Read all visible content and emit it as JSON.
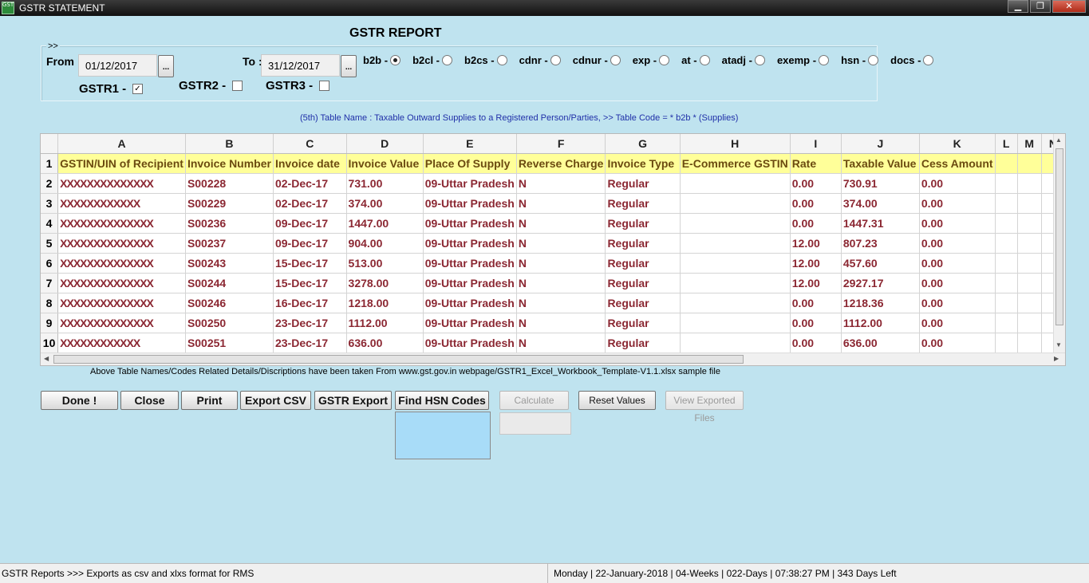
{
  "window": {
    "title": "GSTR STATEMENT",
    "app_icon_text": "GST",
    "controls": {
      "minimize": "▁",
      "maximize": "❐",
      "close": "✕"
    }
  },
  "heading": "GSTR REPORT",
  "filter": {
    "legend": ">>",
    "from_label": "From :",
    "from_value": "01/12/2017",
    "to_label": "To :",
    "to_value": "31/12/2017",
    "picker_label": "...",
    "gstr1_label": "GSTR1 -",
    "gstr1_checked": true,
    "gstr2_label": "GSTR2 -",
    "gstr2_checked": false,
    "gstr3_label": "GSTR3 -",
    "gstr3_checked": false,
    "table_codes": [
      {
        "label": "b2b -",
        "selected": true
      },
      {
        "label": "b2cl -",
        "selected": false
      },
      {
        "label": "b2cs -",
        "selected": false
      },
      {
        "label": "cdnr -",
        "selected": false
      },
      {
        "label": "cdnur -",
        "selected": false
      },
      {
        "label": "exp -",
        "selected": false
      },
      {
        "label": "at -",
        "selected": false
      },
      {
        "label": "atadj -",
        "selected": false
      },
      {
        "label": "exemp -",
        "selected": false
      },
      {
        "label": "hsn -",
        "selected": false
      },
      {
        "label": "docs -",
        "selected": false
      }
    ]
  },
  "table_note": "(5th) Table Name : Taxable Outward Supplies to a Registered Person/Parties, >> Table Code = * b2b * (Supplies)",
  "grid": {
    "columns": [
      "A",
      "B",
      "C",
      "D",
      "E",
      "F",
      "G",
      "H",
      "I",
      "J",
      "K",
      "L",
      "M",
      "N"
    ],
    "header_row": {
      "num": "1",
      "cells": [
        "GSTIN/UIN of Recipient",
        "Invoice Number",
        "Invoice date",
        "Invoice Value",
        "Place Of Supply",
        "Reverse Charge",
        "Invoice Type",
        "E-Commerce GSTIN",
        "Rate",
        "Taxable Value",
        "Cess Amount",
        "",
        "",
        ""
      ]
    },
    "rows": [
      {
        "num": "2",
        "cells": [
          "XXXXXXXXXXXXXX",
          "S00228",
          "02-Dec-17",
          "731.00",
          "09-Uttar Pradesh",
          "N",
          "Regular",
          "",
          "0.00",
          "730.91",
          "0.00",
          "",
          "",
          ""
        ]
      },
      {
        "num": "3",
        "cells": [
          "XXXXXXXXXXXX",
          "S00229",
          "02-Dec-17",
          "374.00",
          "09-Uttar Pradesh",
          "N",
          "Regular",
          "",
          "0.00",
          "374.00",
          "0.00",
          "",
          "",
          ""
        ]
      },
      {
        "num": "4",
        "cells": [
          "XXXXXXXXXXXXXX",
          "S00236",
          "09-Dec-17",
          "1447.00",
          "09-Uttar Pradesh",
          "N",
          "Regular",
          "",
          "0.00",
          "1447.31",
          "0.00",
          "",
          "",
          ""
        ]
      },
      {
        "num": "5",
        "cells": [
          "XXXXXXXXXXXXXX",
          "S00237",
          "09-Dec-17",
          "904.00",
          "09-Uttar Pradesh",
          "N",
          "Regular",
          "",
          "12.00",
          "807.23",
          "0.00",
          "",
          "",
          ""
        ]
      },
      {
        "num": "6",
        "cells": [
          "XXXXXXXXXXXXXX",
          "S00243",
          "15-Dec-17",
          "513.00",
          "09-Uttar Pradesh",
          "N",
          "Regular",
          "",
          "12.00",
          "457.60",
          "0.00",
          "",
          "",
          ""
        ]
      },
      {
        "num": "7",
        "cells": [
          "XXXXXXXXXXXXXX",
          "S00244",
          "15-Dec-17",
          "3278.00",
          "09-Uttar Pradesh",
          "N",
          "Regular",
          "",
          "12.00",
          "2927.17",
          "0.00",
          "",
          "",
          ""
        ]
      },
      {
        "num": "8",
        "cells": [
          "XXXXXXXXXXXXXX",
          "S00246",
          "16-Dec-17",
          "1218.00",
          "09-Uttar Pradesh",
          "N",
          "Regular",
          "",
          "0.00",
          "1218.36",
          "0.00",
          "",
          "",
          ""
        ]
      },
      {
        "num": "9",
        "cells": [
          "XXXXXXXXXXXXXX",
          "S00250",
          "23-Dec-17",
          "1112.00",
          "09-Uttar Pradesh",
          "N",
          "Regular",
          "",
          "0.00",
          "1112.00",
          "0.00",
          "",
          "",
          ""
        ]
      },
      {
        "num": "10",
        "cells": [
          "XXXXXXXXXXXX",
          "S00251",
          "23-Dec-17",
          "636.00",
          "09-Uttar Pradesh",
          "N",
          "Regular",
          "",
          "0.00",
          "636.00",
          "0.00",
          "",
          "",
          ""
        ]
      }
    ]
  },
  "source_note": "Above Table Names/Codes Related Details/Discriptions have been taken From www.gst.gov.in webpage/GSTR1_Excel_Workbook_Template-V1.1.xlsx sample file",
  "buttons": {
    "done": "Done !",
    "close": "Close",
    "print": "Print",
    "export_csv": "Export CSV",
    "gstr_export": "GSTR Export",
    "find_hsn": "Find HSN Codes",
    "calculate": "Calculate Values",
    "reset": "Reset Values",
    "view_exported": "View Exported Files"
  },
  "status": {
    "left": "GSTR Reports >>> Exports as csv and xlxs format for RMS",
    "right": "Monday  |   22-January-2018  | 04-Weeks  | 022-Days  | 07:38:27 PM  | 343 Days Left"
  },
  "colors": {
    "background": "#bfe3ef",
    "cell_text": "#8b2732",
    "header_fill": "#ffff99",
    "note_text": "#1f2fa8",
    "hsn_box": "#a8dcf8"
  }
}
